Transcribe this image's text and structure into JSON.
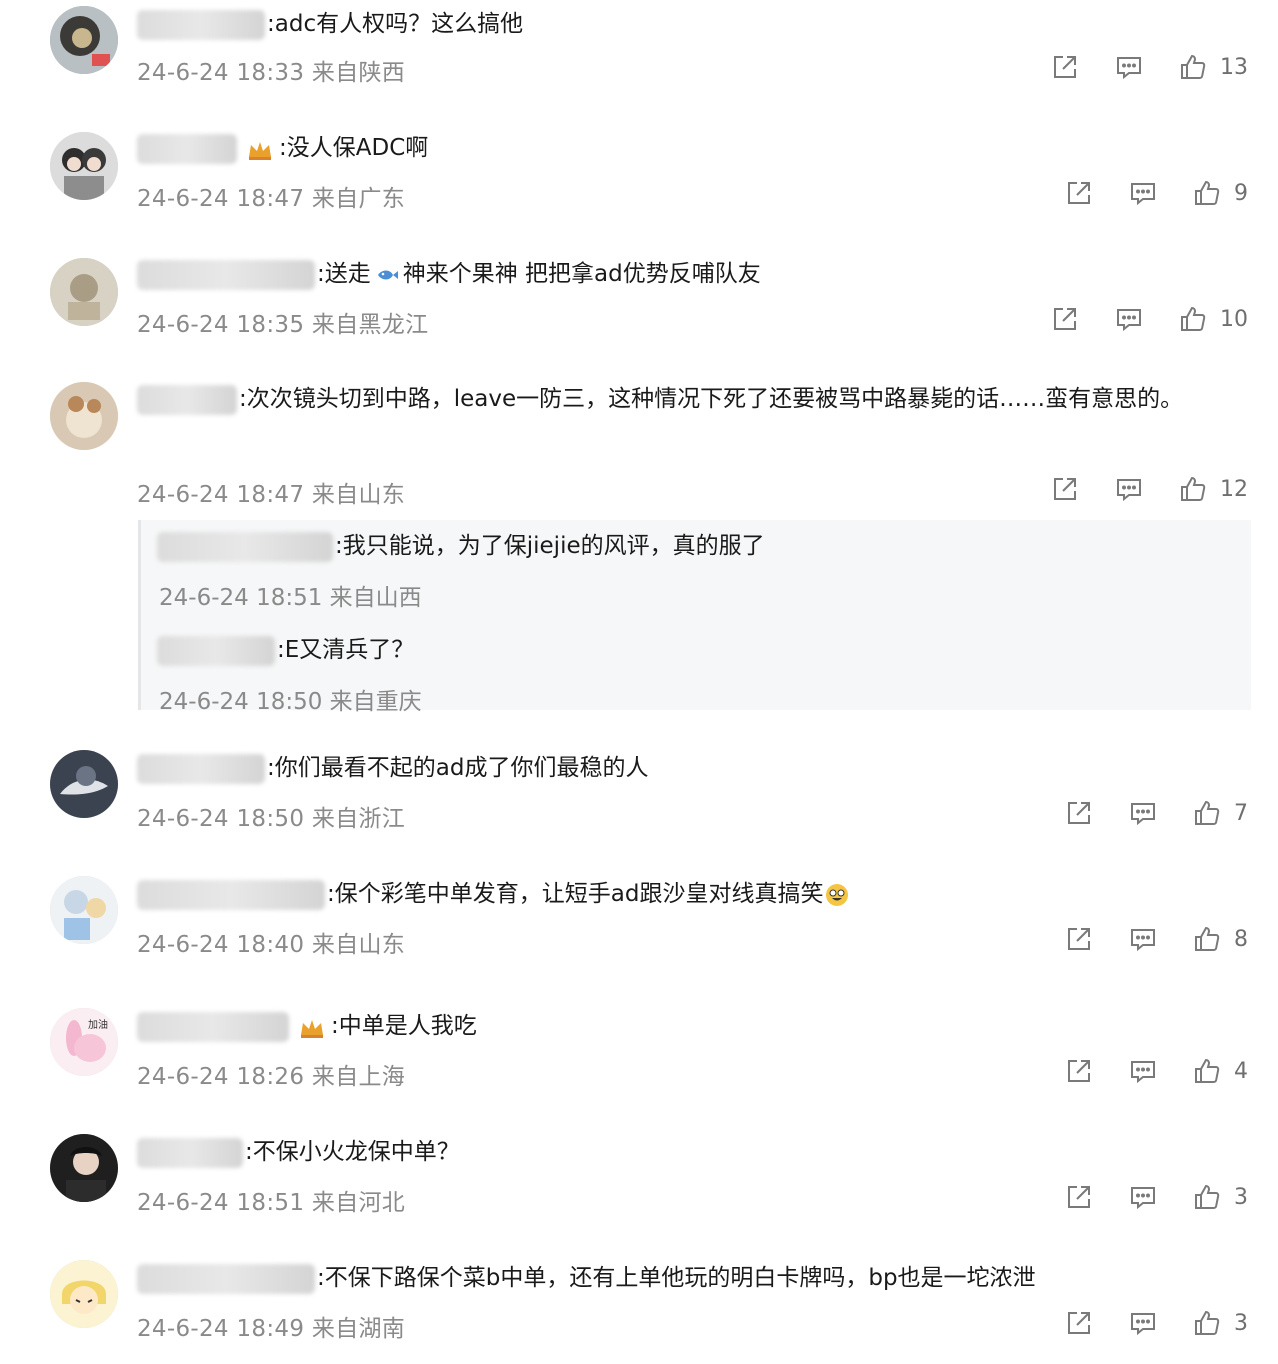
{
  "comments": [
    {
      "text": ":adc有人权吗？这么搞他",
      "time": "24-6-24 18:33",
      "loc": "来自陕西",
      "likes": "13"
    },
    {
      "text": ":没人保ADC啊",
      "time": "24-6-24 18:47",
      "loc": "来自广东",
      "likes": "9"
    },
    {
      "text": ":送走",
      "text2": "神来个果神 把把拿ad优势反哺队友",
      "time": "24-6-24 18:35",
      "loc": "来自黑龙江",
      "likes": "10"
    },
    {
      "text": ":次次镜头切到中路，leave一防三，这种情况下死了还要被骂中路暴毙的话……蛮有意思的。",
      "time": "24-6-24 18:47",
      "loc": "来自山东",
      "likes": "12"
    },
    {
      "text": ":你们最看不起的ad成了你们最稳的人",
      "time": "24-6-24 18:50",
      "loc": "来自浙江",
      "likes": "7"
    },
    {
      "text": ":保个彩笔中单发育，让短手ad跟沙皇对线真搞笑",
      "time": "24-6-24 18:40",
      "loc": "来自山东",
      "likes": "8"
    },
    {
      "text": ":中单是人我吃",
      "time": "24-6-24 18:26",
      "loc": "来自上海",
      "likes": "4"
    },
    {
      "text": ":不保小火龙保中单？",
      "time": "24-6-24 18:51",
      "loc": "来自河北",
      "likes": "3"
    },
    {
      "text": ":不保下路保个菜b中单，还有上单他玩的明白卡牌吗，bp也是一坨浓泄",
      "time": "24-6-24 18:49",
      "loc": "来自湖南",
      "likes": "3"
    }
  ],
  "replies": [
    {
      "text": ":我只能说，为了保jiejie的风评，真的服了",
      "time": "24-6-24 18:51",
      "loc": "来自山西"
    },
    {
      "text": ":E又清兵了？",
      "time": "24-6-24 18:50",
      "loc": "来自重庆"
    }
  ],
  "icons": {
    "share": "share-icon",
    "comment": "comment-icon",
    "like": "thumbs-up-icon",
    "crown": "crown-badge-icon"
  },
  "colors": {
    "meta": "#8a8a8a",
    "icon": "#7a7a7a",
    "reply_bg": "#f6f7f8"
  }
}
